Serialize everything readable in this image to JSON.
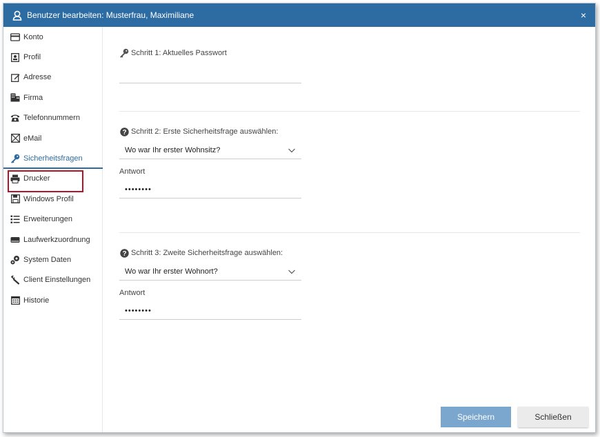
{
  "window": {
    "title": "Benutzer bearbeiten: Musterfrau, Maximiliane",
    "close_glyph": "×"
  },
  "sidebar": {
    "items": [
      {
        "label": "Konto",
        "icon": "card-icon"
      },
      {
        "label": "Profil",
        "icon": "profile-icon"
      },
      {
        "label": "Adresse",
        "icon": "edit-icon"
      },
      {
        "label": "Firma",
        "icon": "building-icon"
      },
      {
        "label": "Telefonnummern",
        "icon": "phone-icon"
      },
      {
        "label": "eMail",
        "icon": "mail-icon"
      },
      {
        "label": "Sicherheitsfragen",
        "icon": "key-icon",
        "active": true
      },
      {
        "label": "Drucker",
        "icon": "printer-icon"
      },
      {
        "label": "Windows Profil",
        "icon": "floppy-icon"
      },
      {
        "label": "Erweiterungen",
        "icon": "list-icon"
      },
      {
        "label": "Laufwerkzuordnung",
        "icon": "drive-icon"
      },
      {
        "label": "System Daten",
        "icon": "gears-icon"
      },
      {
        "label": "Client Einstellungen",
        "icon": "wrench-icon"
      },
      {
        "label": "Historie",
        "icon": "calendar-icon"
      }
    ]
  },
  "form": {
    "step1": {
      "label": "Schritt 1: Aktuelles Passwort",
      "value": ""
    },
    "step2": {
      "label": "Schritt 2: Erste Sicherheitsfrage auswählen:",
      "selected": "Wo war Ihr erster Wohnsitz?",
      "answer_label": "Antwort",
      "answer_value": "••••••••"
    },
    "step3": {
      "label": "Schritt 3: Zweite Sicherheitsfrage auswählen:",
      "selected": "Wo war Ihr erster Wohnort?",
      "answer_label": "Antwort",
      "answer_value": "••••••••"
    }
  },
  "buttons": {
    "save": "Speichern",
    "close": "Schließen"
  },
  "colors": {
    "titlebar": "#2d6ba3",
    "save_button": "#7ba7cf",
    "highlight": "#b1152a"
  }
}
